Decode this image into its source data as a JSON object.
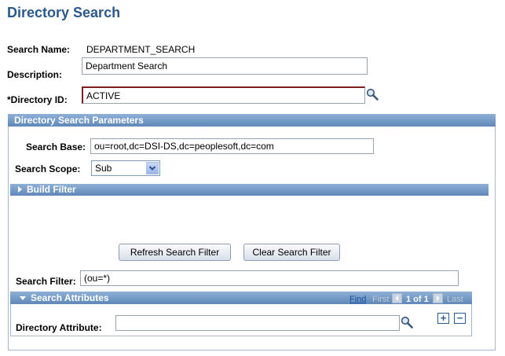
{
  "page": {
    "title": "Directory Search"
  },
  "header": {
    "search_name_label": "Search Name:",
    "search_name_value": "DEPARTMENT_SEARCH",
    "description_label": "Description:",
    "description_value": "Department Search",
    "directory_id_label": "*Directory ID:",
    "directory_id_value": "ACTIVE",
    "lookup_icon": "magnifier-icon"
  },
  "params": {
    "title": "Directory Search Parameters",
    "search_base_label": "Search Base:",
    "search_base_value": "ou=root,dc=DSI-DS,dc=peoplesoft,dc=com",
    "search_scope_label": "Search Scope:",
    "search_scope_value": "Sub",
    "build_filter_label": "Build Filter",
    "refresh_button": "Refresh Search Filter",
    "clear_button": "Clear Search Filter",
    "search_filter_label": "Search Filter:",
    "search_filter_value": "(ou=*)"
  },
  "attributes": {
    "title": "Search Attributes",
    "find": "Find",
    "first": "First",
    "page_info": "1 of 1",
    "last": "Last",
    "directory_attribute_label": "Directory Attribute:",
    "directory_attribute_value": "",
    "add_symbol": "+",
    "remove_symbol": "−"
  },
  "colors": {
    "title": "#2a5891",
    "group_header": "#6f95c3",
    "link": "#1a4fa3"
  }
}
